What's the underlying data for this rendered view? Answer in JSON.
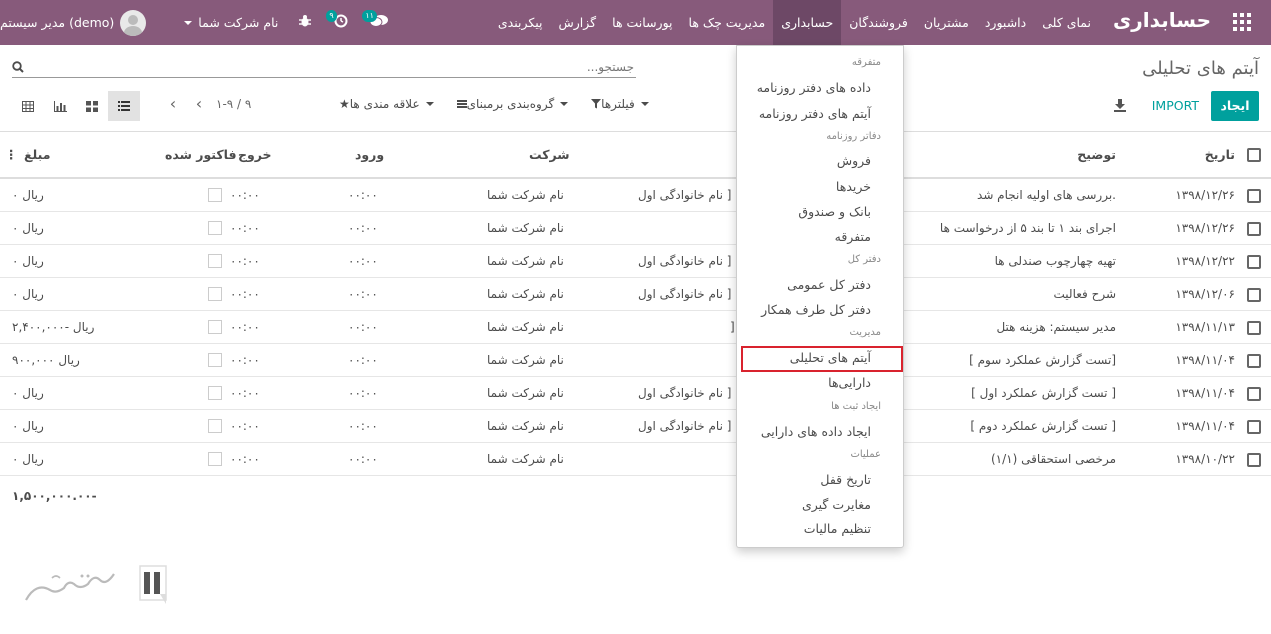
{
  "navbar": {
    "brand": "حسابداری",
    "menu": [
      {
        "label": "نمای کلی",
        "active": false
      },
      {
        "label": "داشبورد",
        "active": false
      },
      {
        "label": "مشتریان",
        "active": false
      },
      {
        "label": "فروشندگان",
        "active": false
      },
      {
        "label": "حسابداری",
        "active": true
      },
      {
        "label": "مدیریت چک ها",
        "active": false
      },
      {
        "label": "پورسانت ها",
        "active": false
      },
      {
        "label": "گزارش",
        "active": false
      },
      {
        "label": "پیکربندی",
        "active": false
      }
    ],
    "user_name": "مدیر سیستم (demo)",
    "company_name": "نام شرکت شما",
    "messages_count": "۱۱",
    "activity_count": "۹",
    "colors": {
      "navbar": "#875a7b",
      "active": "#6d4866",
      "accent": "#00a09d"
    }
  },
  "control_panel": {
    "title": "آیتم های تحلیلی",
    "search_placeholder": "جستجو...",
    "create_label": "ایجاد",
    "import_label": "IMPORT",
    "filters_label": "فیلترها",
    "groupby_label": "گروه‌بندی برمبنای",
    "favorites_label": "علاقه مندی ها",
    "pager": "۱-۹ / ۹"
  },
  "table": {
    "headers": {
      "date": "تاریخ",
      "description": "توضیح",
      "company": "شرکت",
      "input": "ورود",
      "output": "خروج",
      "invoiced": "فاکتور شده",
      "amount": "مبلغ"
    },
    "rows": [
      {
        "date": "۱۳۹۸/۱۲/۲۶",
        "description": "بررسی های اولیه انجام شد.",
        "partner": "نام خانوادگی اول ]",
        "company": "نام شرکت شما",
        "input": "۰۰:۰۰",
        "output": "۰۰:۰۰",
        "amount": "۰ ریال"
      },
      {
        "date": "۱۳۹۸/۱۲/۲۶",
        "description": "اجرای بند ۱ تا بند ۵ از درخواست ها",
        "partner": "",
        "company": "نام شرکت شما",
        "input": "۰۰:۰۰",
        "output": "۰۰:۰۰",
        "amount": "۰ ریال"
      },
      {
        "date": "۱۳۹۸/۱۲/۲۲",
        "description": "تهیه چهارچوب صندلی ها",
        "partner": "نام خانوادگی اول ]",
        "company": "نام شرکت شما",
        "input": "۰۰:۰۰",
        "output": "۰۰:۰۰",
        "amount": "۰ ریال"
      },
      {
        "date": "۱۳۹۸/۱۲/۰۶",
        "description": "شرح فعالیت",
        "partner": "نام خانوادگی اول ]",
        "company": "نام شرکت شما",
        "input": "۰۰:۰۰",
        "output": "۰۰:۰۰",
        "amount": "۰ ریال"
      },
      {
        "date": "۱۳۹۸/۱۱/۱۳",
        "description": "مدیر سیستم: هزینه هتل",
        "partner": "]",
        "company": "نام شرکت شما",
        "input": "۰۰:۰۰",
        "output": "۰۰:۰۰",
        "amount": "۲,۴۰۰,۰۰۰- ریال"
      },
      {
        "date": "۱۳۹۸/۱۱/۰۴",
        "description": "[ تست گزارش عملکرد سوم]",
        "partner": "",
        "company": "نام شرکت شما",
        "input": "۰۰:۰۰",
        "output": "۰۰:۰۰",
        "amount": "۹۰۰,۰۰۰ ریال"
      },
      {
        "date": "۱۳۹۸/۱۱/۰۴",
        "description": "[ تست گزارش عملکرد اول ]",
        "partner": "نام خانوادگی اول ]",
        "company": "نام شرکت شما",
        "input": "۰۰:۰۰",
        "output": "۰۰:۰۰",
        "amount": "۰ ریال"
      },
      {
        "date": "۱۳۹۸/۱۱/۰۴",
        "description": "[ تست گزارش عملکرد دوم ]",
        "partner": "نام خانوادگی اول ]",
        "company": "نام شرکت شما",
        "input": "۰۰:۰۰",
        "output": "۰۰:۰۰",
        "amount": "۰ ریال"
      },
      {
        "date": "۱۳۹۸/۱۰/۲۲",
        "description": "مرخصی استحقاقی (۱/۱)",
        "partner": "",
        "company": "نام شرکت شما",
        "input": "۰۰:۰۰",
        "output": "۰۰:۰۰",
        "amount": "۰ ریال"
      }
    ],
    "total": "۱,۵۰۰,۰۰۰.۰۰-"
  },
  "dropdown": {
    "h_misc": "متفرقه",
    "journal_data": "داده های دفتر روزنامه",
    "journal_items": "آیتم های دفتر روزنامه",
    "h_journals": "دفاتر روزنامه",
    "sales": "فروش",
    "purchases": "خریدها",
    "bank_cash": "بانک و صندوق",
    "misc": "متفرقه",
    "h_ledger": "دفتر کل",
    "general_ledger": "دفتر کل عمومی",
    "partner_ledger": "دفتر کل طرف همکار",
    "h_management": "مدیریت",
    "analytic_items": "آیتم های تحلیلی",
    "assets": "دارایی‌ها",
    "h_create_entries": "ایجاد ثبت ها",
    "create_asset_data": "ایجاد داده های دارایی",
    "h_operations": "عملیات",
    "lock_date": "تاریخ قفل",
    "reconciliation": "مغایرت گیری",
    "tax_settings": "تنظیم مالیات"
  }
}
